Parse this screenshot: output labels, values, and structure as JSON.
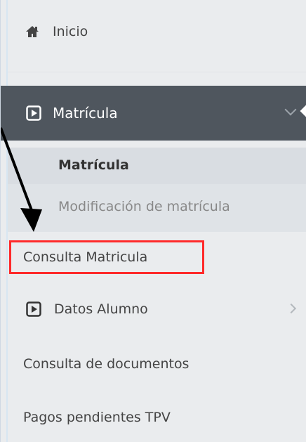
{
  "sidebar": {
    "inicio": {
      "label": "Inicio",
      "icon": "home-icon"
    },
    "matricula": {
      "label": "Matrícula",
      "icon": "play-square-icon",
      "submenu": [
        {
          "label": "Matrícula"
        },
        {
          "label": "Modificación de matrícula"
        }
      ]
    },
    "consulta_matricula": {
      "label": "Consulta Matricula"
    },
    "datos_alumno": {
      "label": "Datos Alumno",
      "icon": "play-square-icon"
    },
    "consulta_documentos": {
      "label": "Consulta de documentos"
    },
    "pagos_tpv": {
      "label": "Pagos pendientes TPV"
    }
  },
  "annotation": {
    "highlight_color": "#ff2a2a",
    "arrow_color": "#000000"
  },
  "colors": {
    "active_header_bg": "#4f565e",
    "sidebar_bg": "#eaecee",
    "submenu_bg": "#dfe3e7"
  }
}
